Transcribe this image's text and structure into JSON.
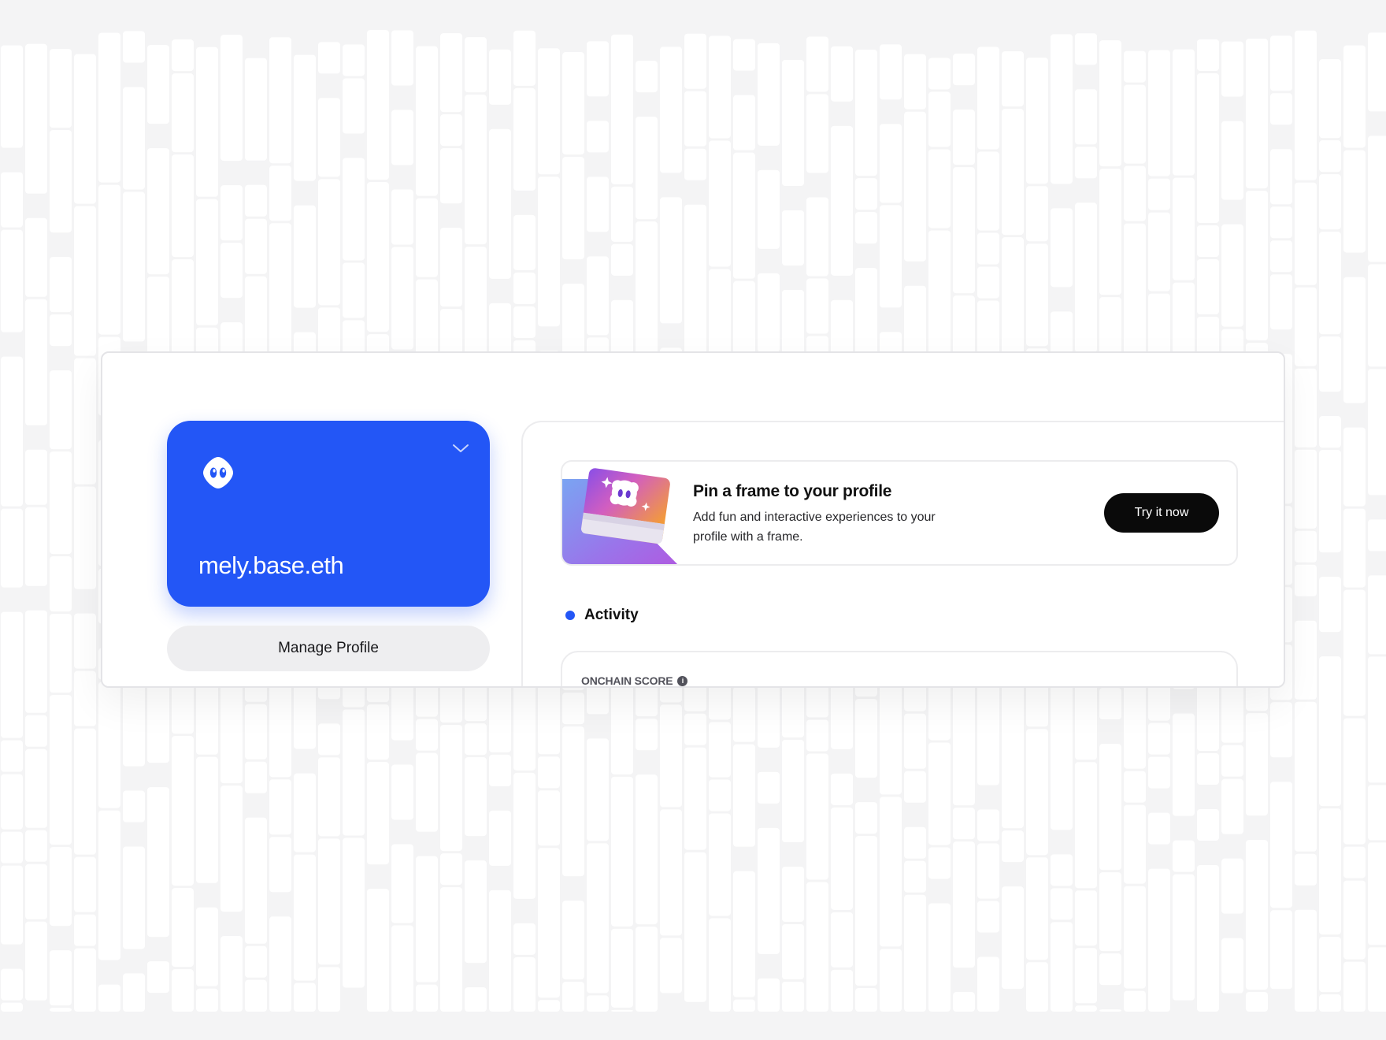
{
  "profile_card": {
    "handle": "mely.base.eth",
    "logo_icon": "basename-smiley-logo",
    "dropdown_icon": "chevron-down-icon",
    "color": "#2356f6"
  },
  "manage_profile": {
    "label": "Manage Profile"
  },
  "promo": {
    "title": "Pin a frame to your profile",
    "description": "Add fun and interactive experiences to your profile with a frame.",
    "cta_label": "Try it now"
  },
  "activity": {
    "label": "Activity",
    "dot_color": "#2356f6"
  },
  "onchain_score": {
    "label": "ONCHAIN SCORE",
    "info_icon": "info-icon"
  }
}
